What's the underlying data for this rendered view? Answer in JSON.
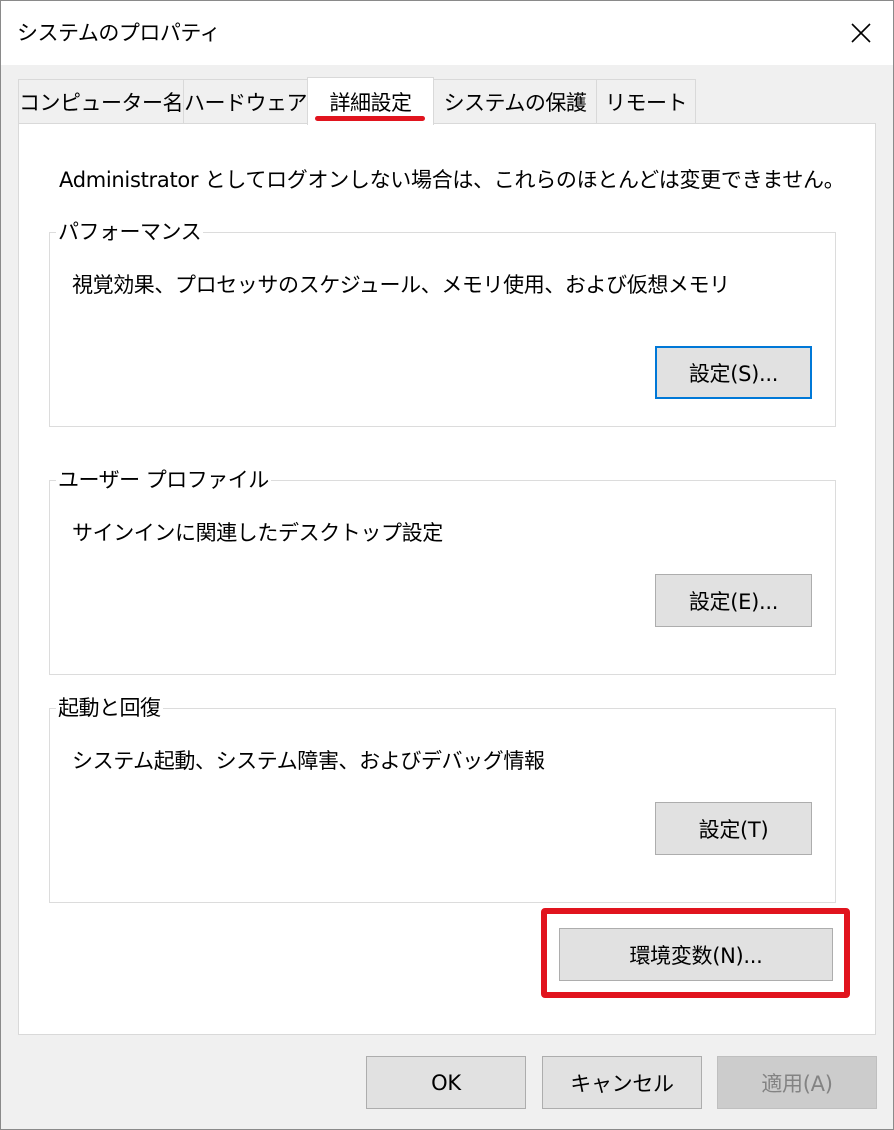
{
  "window": {
    "title": "システムのプロパティ"
  },
  "tabs": [
    {
      "label": "コンピューター名"
    },
    {
      "label": "ハードウェア"
    },
    {
      "label": "詳細設定"
    },
    {
      "label": "システムの保護"
    },
    {
      "label": "リモート"
    }
  ],
  "active_tab": "詳細設定",
  "notice": "Administrator としてログオンしない場合は、これらのほとんどは変更できません。",
  "groups": {
    "performance": {
      "title": "パフォーマンス",
      "description": "視覚効果、プロセッサのスケジュール、メモリ使用、および仮想メモリ",
      "button": "設定(S)..."
    },
    "user_profile": {
      "title": "ユーザー プロファイル",
      "description": "サインインに関連したデスクトップ設定",
      "button": "設定(E)..."
    },
    "startup_recovery": {
      "title": "起動と回復",
      "description": "システム起動、システム障害、およびデバッグ情報",
      "button": "設定(T)"
    }
  },
  "env_button": "環境変数(N)...",
  "footer": {
    "ok": "OK",
    "cancel": "キャンセル",
    "apply": "適用(A)"
  },
  "colors": {
    "highlight": "#e1141e",
    "focus_border": "#0078d7"
  },
  "icons": {
    "close": "close-icon"
  }
}
